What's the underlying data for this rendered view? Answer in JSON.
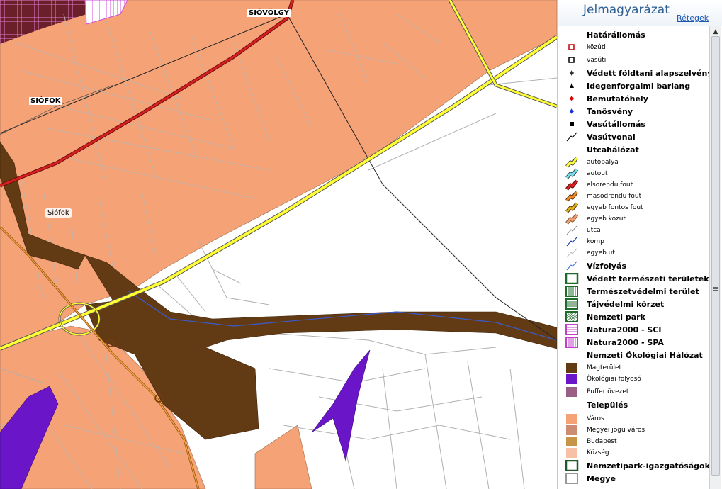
{
  "map": {
    "labels": {
      "siofok_station": "SIÓFOK",
      "siovolgy_station": "SIÓVÖLGY",
      "siofok_town": "Siófok"
    }
  },
  "legend": {
    "title": "Jelmagyarázat",
    "layers_link": "Rétegek",
    "items": [
      {
        "label": "Határállomás",
        "kind": "header",
        "icon": "none"
      },
      {
        "label": "közúti",
        "kind": "small",
        "icon": "hollow-square-red"
      },
      {
        "label": "vasúti",
        "kind": "small",
        "icon": "hollow-square-black"
      },
      {
        "label": "Védett földtani alapszelvény",
        "kind": "normal",
        "icon": "diamond-black"
      },
      {
        "label": "Idegenforgalmi barlang",
        "kind": "normal",
        "icon": "triangle-black"
      },
      {
        "label": "Bemutatóhely",
        "kind": "normal",
        "icon": "diamond-red"
      },
      {
        "label": "Tanösvény",
        "kind": "normal",
        "icon": "diamond-blue"
      },
      {
        "label": "Vasútállomás",
        "kind": "normal",
        "icon": "square-black"
      },
      {
        "label": "Vasútvonal",
        "kind": "normal",
        "icon": "line-black"
      },
      {
        "label": "Utcahálózat",
        "kind": "header",
        "icon": "none"
      },
      {
        "label": "autopalya",
        "kind": "small",
        "icon": "road-yellow"
      },
      {
        "label": "autout",
        "kind": "small",
        "icon": "road-cyan"
      },
      {
        "label": "elsorendu fout",
        "kind": "small",
        "icon": "road-red"
      },
      {
        "label": "masodrendu fout",
        "kind": "small",
        "icon": "road-orange"
      },
      {
        "label": "egyeb fontos fout",
        "kind": "small",
        "icon": "road-gold"
      },
      {
        "label": "egyeb kozut",
        "kind": "small",
        "icon": "road-salmon"
      },
      {
        "label": "utca",
        "kind": "small",
        "icon": "line-grey"
      },
      {
        "label": "komp",
        "kind": "small",
        "icon": "line-blue"
      },
      {
        "label": "egyeb ut",
        "kind": "small",
        "icon": "line-lightgrey"
      },
      {
        "label": "Vízfolyás",
        "kind": "normal",
        "icon": "line-water"
      },
      {
        "label": "Védett természeti területek",
        "kind": "normal",
        "icon": "box-green"
      },
      {
        "label": "Természetvédelmi terület",
        "kind": "normal",
        "icon": "box-green-vlines"
      },
      {
        "label": "Tájvédelmi körzet",
        "kind": "normal",
        "icon": "box-green-hlines"
      },
      {
        "label": "Nemzeti park",
        "kind": "normal",
        "icon": "box-green-cross"
      },
      {
        "label": "Natura2000 - SCI",
        "kind": "normal",
        "icon": "box-magenta-hlines"
      },
      {
        "label": "Natura2000 - SPA",
        "kind": "normal",
        "icon": "box-magenta-vlines"
      },
      {
        "label": "Nemzeti Ökológiai Hálózat",
        "kind": "header",
        "icon": "none"
      },
      {
        "label": "Magterület",
        "kind": "small",
        "icon": "fill-brown"
      },
      {
        "label": "Ökológiai folyosó",
        "kind": "small",
        "icon": "fill-purple"
      },
      {
        "label": "Puffer övezet",
        "kind": "small",
        "icon": "fill-mauve"
      },
      {
        "label": "Település",
        "kind": "header",
        "icon": "none"
      },
      {
        "label": "Város",
        "kind": "small",
        "icon": "fill-salmon"
      },
      {
        "label": "Megyei jogu város",
        "kind": "small",
        "icon": "fill-rosybrown"
      },
      {
        "label": "Budapest",
        "kind": "small",
        "icon": "fill-tan"
      },
      {
        "label": "Község",
        "kind": "small",
        "icon": "fill-pink"
      },
      {
        "label": "Nemzetipark-igazgatóságok",
        "kind": "normal",
        "icon": "outline-darkgreen"
      },
      {
        "label": "Megye",
        "kind": "normal",
        "icon": "outline-grey"
      }
    ]
  },
  "colors": {
    "settlement": "#f4a276",
    "core_area": "#623b14",
    "corridor": "#6a16c8",
    "motorway": "#ffff33",
    "primary_road": "#d81e1e",
    "legend_title": "#2f5f94"
  }
}
